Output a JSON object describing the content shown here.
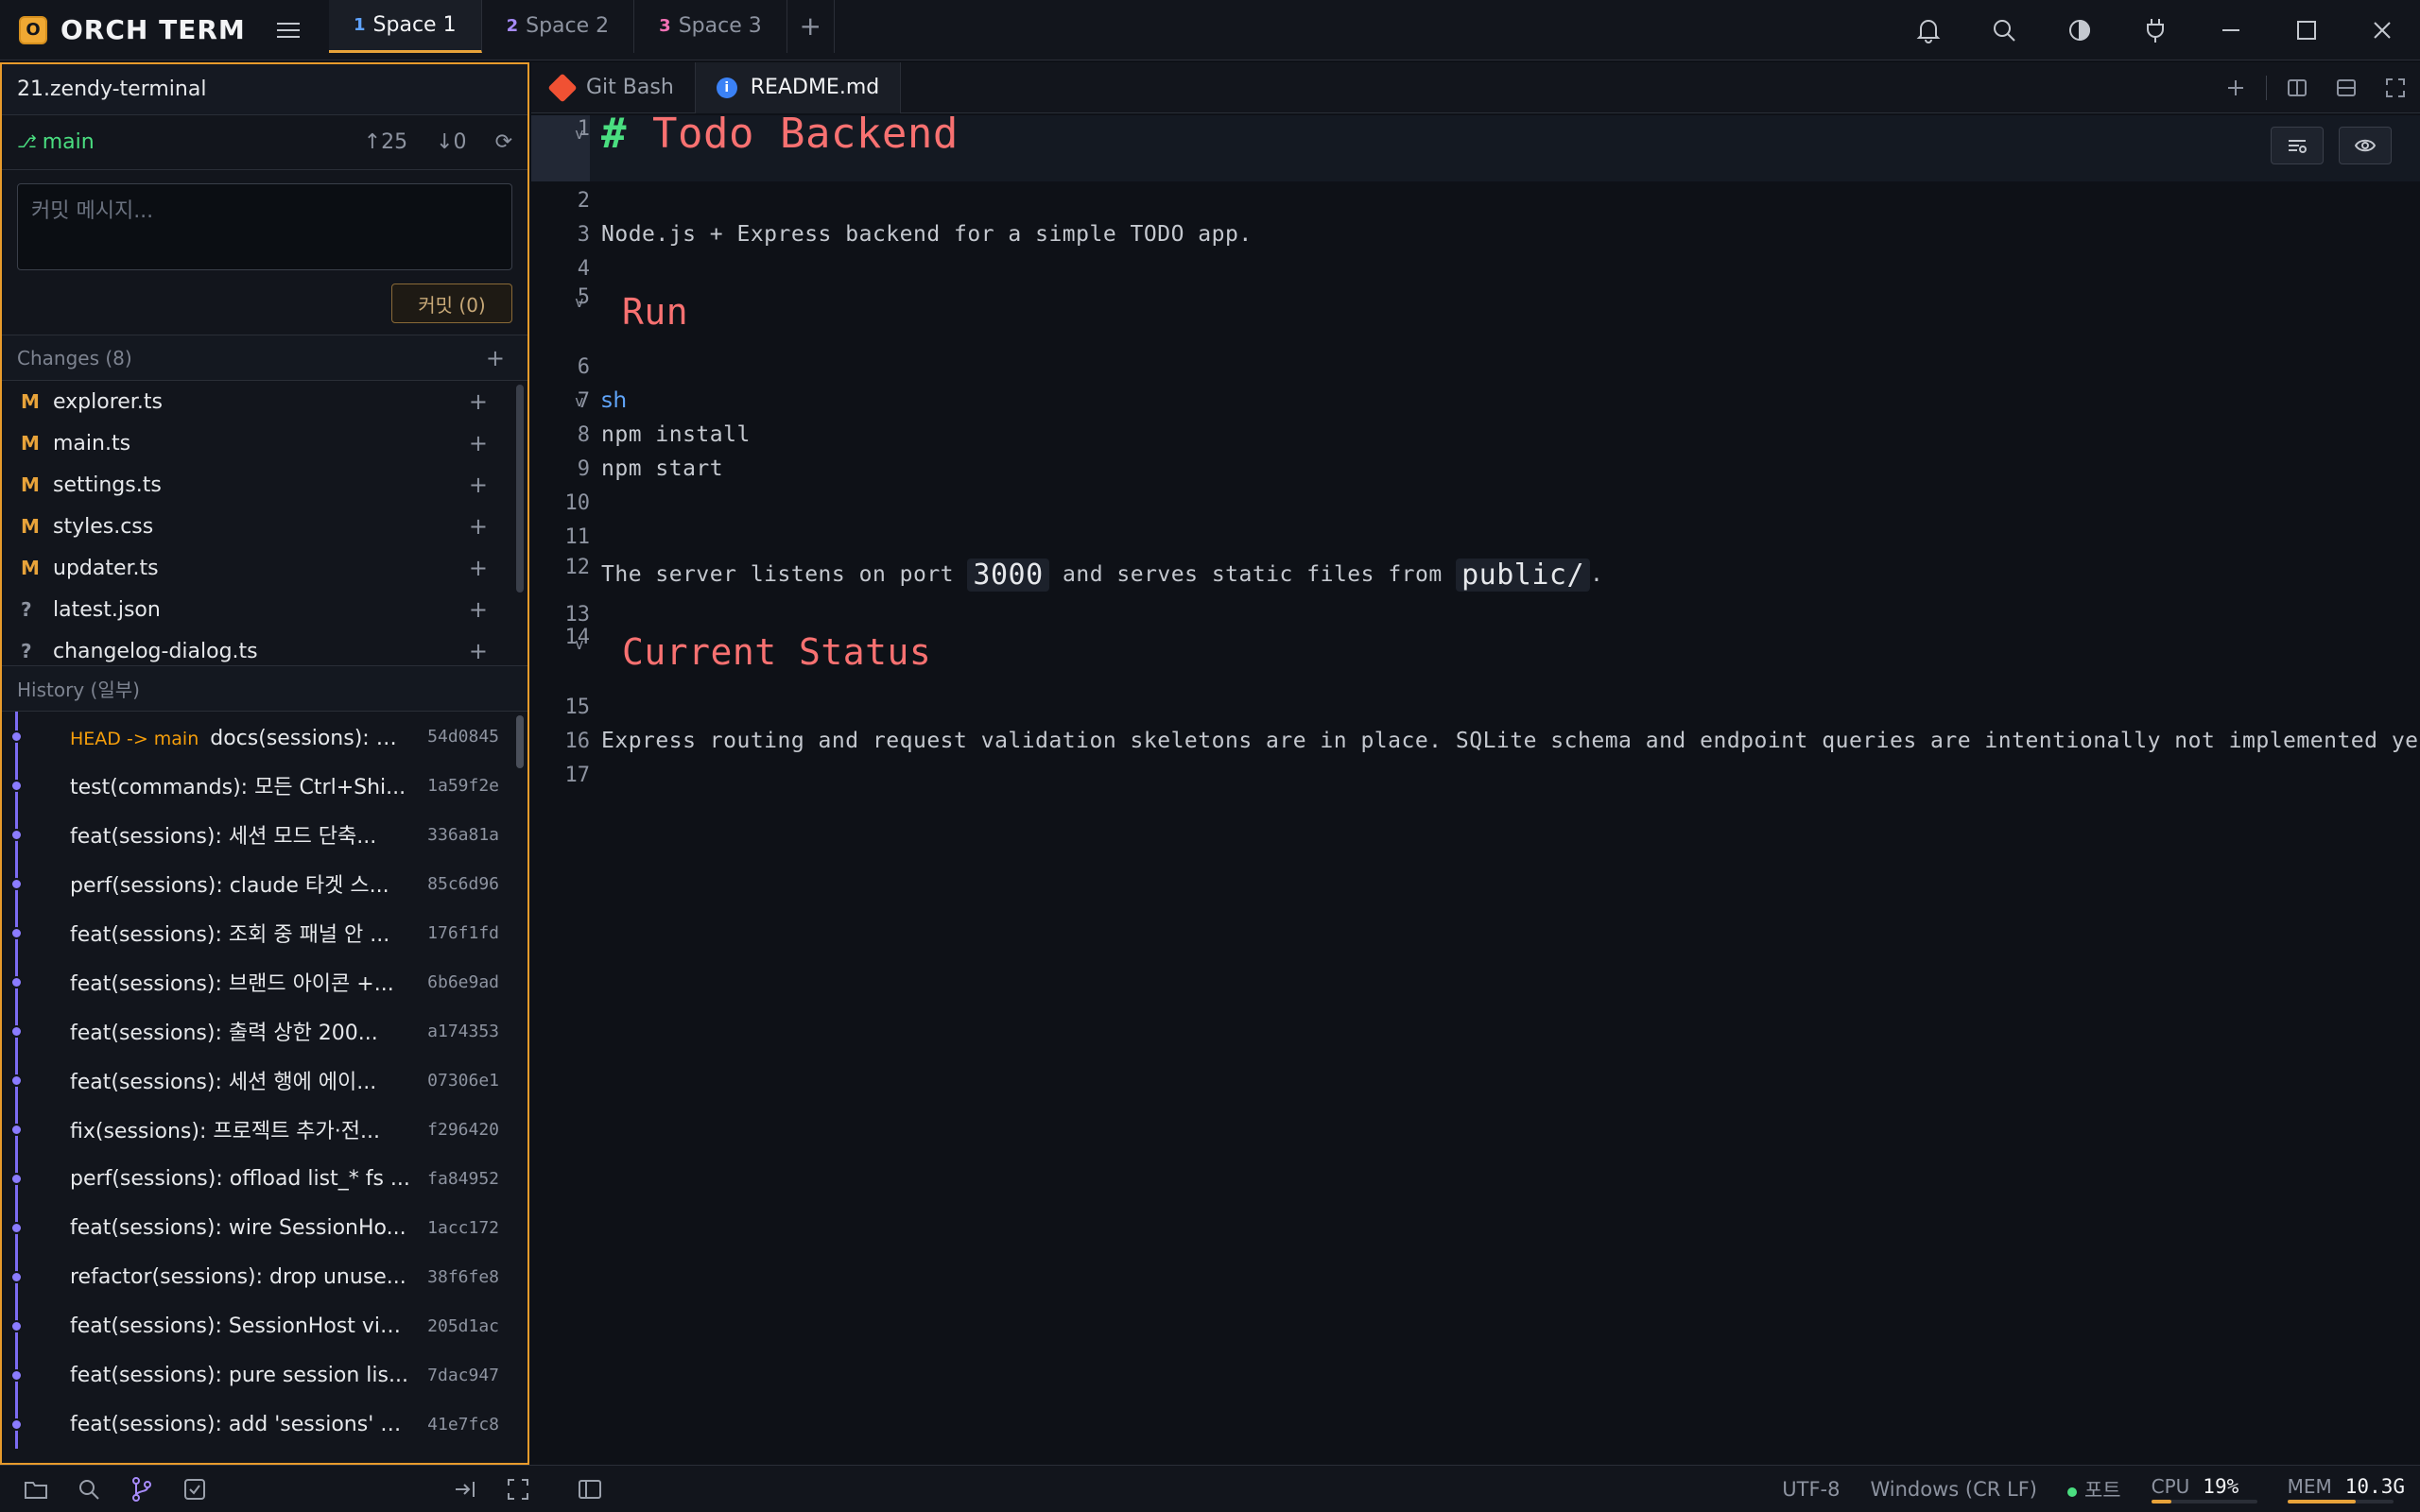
{
  "app": {
    "logo_letter": "O",
    "name": "ORCH TERM"
  },
  "workspaces": [
    {
      "num": "1",
      "label": "Space 1"
    },
    {
      "num": "2",
      "label": "Space 2"
    },
    {
      "num": "3",
      "label": "Space 3"
    }
  ],
  "workspace_add": "+",
  "repo": {
    "name": "21.zendy-terminal",
    "branch": "main",
    "ahead": "↑25",
    "behind": "↓0"
  },
  "commit": {
    "placeholder": "커밋 메시지...",
    "button_label": "커밋 (0)"
  },
  "changes": {
    "header": "Changes (8)",
    "items": [
      {
        "status": "M",
        "file": "explorer.ts"
      },
      {
        "status": "M",
        "file": "main.ts"
      },
      {
        "status": "M",
        "file": "settings.ts"
      },
      {
        "status": "M",
        "file": "styles.css"
      },
      {
        "status": "M",
        "file": "updater.ts"
      },
      {
        "status": "?",
        "file": "latest.json"
      },
      {
        "status": "?",
        "file": "changelog-dialog.ts"
      }
    ]
  },
  "history": {
    "header": "History (일부)",
    "head_tag": "HEAD -> main",
    "commits": [
      {
        "msg": "docs(sessions): 세...",
        "hash": "54d0845"
      },
      {
        "msg": "test(commands): 모든 Ctrl+Shi...",
        "hash": "1a59f2e"
      },
      {
        "msg": "feat(sessions): 세션 모드 단축...",
        "hash": "336a81a"
      },
      {
        "msg": "perf(sessions): claude 타겟 스...",
        "hash": "85c6d96"
      },
      {
        "msg": "feat(sessions): 조회 중 패널 안 ...",
        "hash": "176f1fd"
      },
      {
        "msg": "feat(sessions): 브랜드 아이콘 +...",
        "hash": "6b6e9ad"
      },
      {
        "msg": "feat(sessions): 출력 상한 200...",
        "hash": "a174353"
      },
      {
        "msg": "feat(sessions): 세션 행에 에이...",
        "hash": "07306e1"
      },
      {
        "msg": "fix(sessions): 프로젝트 추가·전...",
        "hash": "f296420"
      },
      {
        "msg": "perf(sessions): offload list_* fs ...",
        "hash": "fa84952"
      },
      {
        "msg": "feat(sessions): wire SessionHo...",
        "hash": "1acc172"
      },
      {
        "msg": "refactor(sessions): drop unuse...",
        "hash": "38f6fe8"
      },
      {
        "msg": "feat(sessions): SessionHost vie...",
        "hash": "205d1ac"
      },
      {
        "msg": "feat(sessions): pure session lis...",
        "hash": "7dac947"
      },
      {
        "msg": "feat(sessions): add 'sessions' s...",
        "hash": "41e7fc8"
      }
    ]
  },
  "editor_tabs": [
    {
      "label": "Git Bash",
      "icon": "git-icon"
    },
    {
      "label": "README.md",
      "icon": "info-icon"
    }
  ],
  "readme": {
    "h1_hash": "#",
    "h1": "Todo Backend",
    "line3": "Node.js + Express backend for a simple TODO app.",
    "h2_run": "Run",
    "lang": "sh",
    "line8": "npm install",
    "line9": "npm start",
    "line12_a": "The server listens on port",
    "line12_port": "3000",
    "line12_b": "and serves static files from",
    "line12_dir": "public/",
    "line12_end": ".",
    "h2_status": "Current Status",
    "line16": "Express routing and request validation skeletons are in place. SQLite schema and endpoint queries are intentionally not implemented yet be"
  },
  "line_numbers": [
    "1",
    "2",
    "3",
    "4",
    "5",
    "6",
    "7",
    "8",
    "9",
    "10",
    "11",
    "12",
    "13",
    "14",
    "15",
    "16",
    "17"
  ],
  "status": {
    "encoding": "UTF-8",
    "line_ending": "Windows (CR LF)",
    "ports": "포트",
    "cpu_label": "CPU",
    "cpu_value": "19%",
    "cpu_fraction": 0.19,
    "mem_label": "MEM",
    "mem_value": "10.3G",
    "mem_fraction": 0.65
  },
  "colors": {
    "accent": "#e89b2c",
    "branch": "#4ade80",
    "graph": "#8b7cff",
    "heading": "#f87171"
  }
}
